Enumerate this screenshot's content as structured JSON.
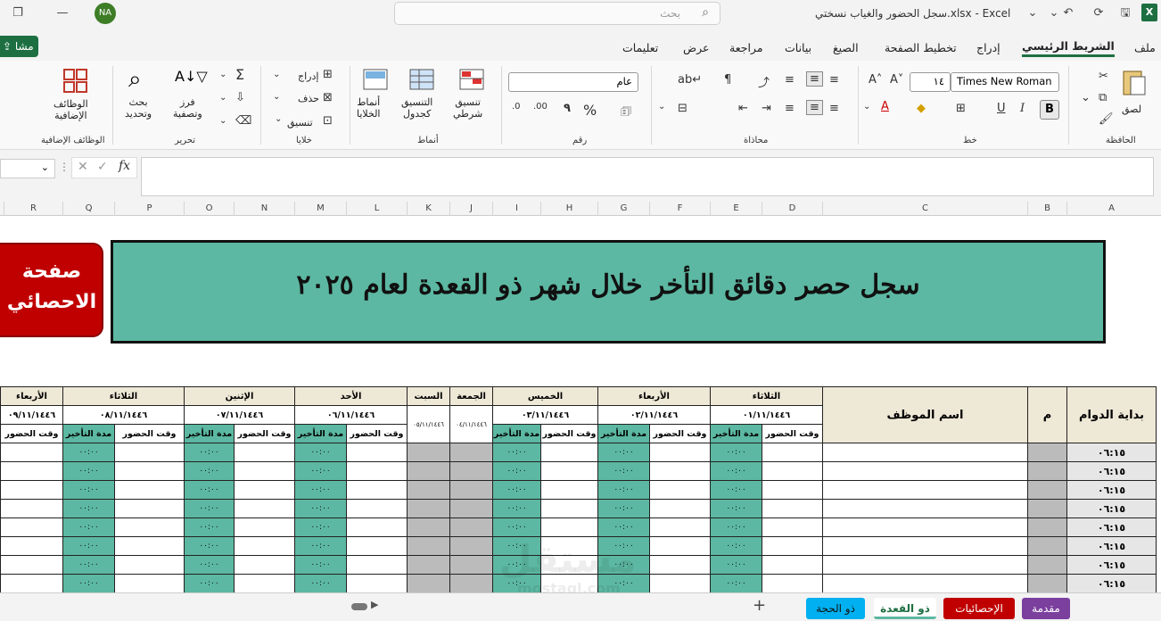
{
  "window": {
    "user_initials": "NA",
    "search_placeholder": "بحث",
    "doc_title": "سجل الحضور والغياب نسختي.xlsx  -  Excel"
  },
  "tabs": [
    {
      "label": "ملف"
    },
    {
      "label": "الشريط الرئيسي"
    },
    {
      "label": "إدراج"
    },
    {
      "label": "تخطيط الصفحة"
    },
    {
      "label": "الصيغ"
    },
    {
      "label": "بيانات"
    },
    {
      "label": "مراجعة"
    },
    {
      "label": "عرض"
    },
    {
      "label": "تعليمات"
    }
  ],
  "share_label": "مشا",
  "ribbon": {
    "clipboard": {
      "paste": "لصق",
      "group": "الحافظة"
    },
    "font": {
      "name": "Times New Roman",
      "size": "١٤",
      "bold": "B",
      "italic": "I",
      "underline": "U",
      "group": "خط"
    },
    "alignment": {
      "group": "محاذاة"
    },
    "number": {
      "format": "عام",
      "group": "رقم"
    },
    "styles": {
      "conditional": "تنسيق\nشرطي",
      "table": "التنسيق\nكجدول",
      "cell": "أنماط\nالخلايا",
      "group": "أنماط"
    },
    "cells": {
      "insert": "إدراج",
      "delete": "حذف",
      "format": "تنسيق",
      "group": "خلايا"
    },
    "editing": {
      "sort": "فرز\nوتصفية",
      "find": "بحث\nوتحديد",
      "group": "تحرير"
    },
    "addins": {
      "label": "الوظائف\nالإضافية",
      "group": "الوظائف الإضافية"
    }
  },
  "columns": [
    "A",
    "B",
    "C",
    "D",
    "E",
    "F",
    "G",
    "H",
    "I",
    "J",
    "K",
    "L",
    "M",
    "N",
    "O",
    "P",
    "Q",
    "R"
  ],
  "sheet": {
    "title": "سجل حصر دقائق التأخر خلال شهر ذو القعدة لعام ٢٠٢٥",
    "stats_button_line1": "صفحة",
    "stats_button_line2": "الاحصائي",
    "header_start": "بداية الدوام",
    "header_m": "م",
    "header_name": "اسم الموظف",
    "sub_attend": "وقت الحضور",
    "sub_late": "مدة التأخير",
    "days": [
      {
        "day": "الأربعاء",
        "date": "٠٩/١١/١٤٤٦"
      },
      {
        "day": "الثلاثاء",
        "date": "٠٨/١١/١٤٤٦"
      },
      {
        "day": "الإثنين",
        "date": "٠٧/١١/١٤٤٦"
      },
      {
        "day": "الأحد",
        "date": "٠٦/١١/١٤٤٦"
      },
      {
        "day": "السبت",
        "date": "٠٥/١١/١٤٤٦"
      },
      {
        "day": "الجمعة",
        "date": "٠٤/١١/١٤٤٦"
      },
      {
        "day": "الخميس",
        "date": "٠٣/١١/١٤٤٦"
      },
      {
        "day": "الأربعاء",
        "date": "٠٢/١١/١٤٤٦"
      },
      {
        "day": "الثلاثاء",
        "date": "٠١/١١/١٤٤٦"
      }
    ],
    "start_time": "٠٦:١٥",
    "late_zero": "٠٠:٠٠",
    "row_count": 8
  },
  "sheet_tabs": [
    {
      "label": "مقدمة",
      "color": "#7b3f9e"
    },
    {
      "label": "الإحصائيات",
      "color": "#c00000"
    },
    {
      "label": "ذو القعدة",
      "color": "#5cb8a2"
    },
    {
      "label": "ذو الحجة",
      "color": "#00b0f0"
    }
  ],
  "watermark": "mostaql.com"
}
